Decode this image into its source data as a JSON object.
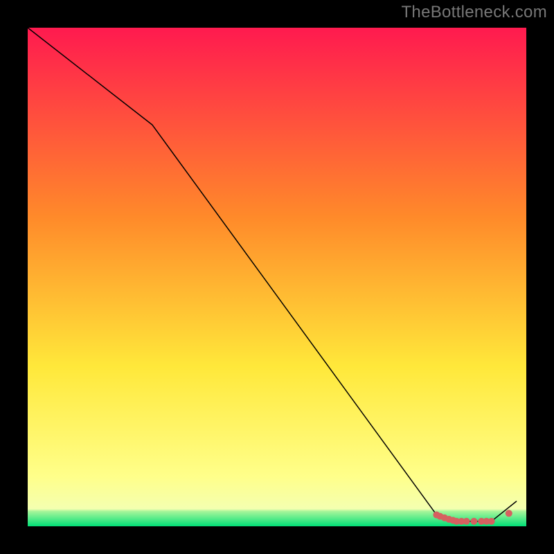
{
  "watermark": "TheBottleneck.com",
  "chart_data": {
    "type": "line",
    "title": "",
    "xlabel": "",
    "ylabel": "",
    "xlim": [
      0,
      100
    ],
    "ylim": [
      0,
      100
    ],
    "grid": false,
    "legend": false,
    "background_gradient": {
      "top_color": "#ff1a4f",
      "mid_color": "#ffef3a",
      "bottom_band_color": "#00e077",
      "bottom_band_start_fraction": 0.965
    },
    "series": [
      {
        "name": "bottleneck-curve",
        "stroke": "#000000",
        "stroke_width": 1.5,
        "x": [
          0,
          25,
          82,
          86,
          93,
          98
        ],
        "values": [
          100,
          80.5,
          2.3,
          1.0,
          1.0,
          5.0
        ]
      }
    ],
    "scatter": {
      "name": "highlight-points",
      "fill": "#d66060",
      "radius": 5,
      "x": [
        82.0,
        82.7,
        83.6,
        84.5,
        85.3,
        86.0,
        87.0,
        88.0,
        89.5,
        91.0,
        92.0,
        93.0,
        96.5
      ],
      "values": [
        2.3,
        2.0,
        1.7,
        1.4,
        1.2,
        1.0,
        1.0,
        1.0,
        1.0,
        1.0,
        1.0,
        1.0,
        2.6
      ]
    }
  }
}
